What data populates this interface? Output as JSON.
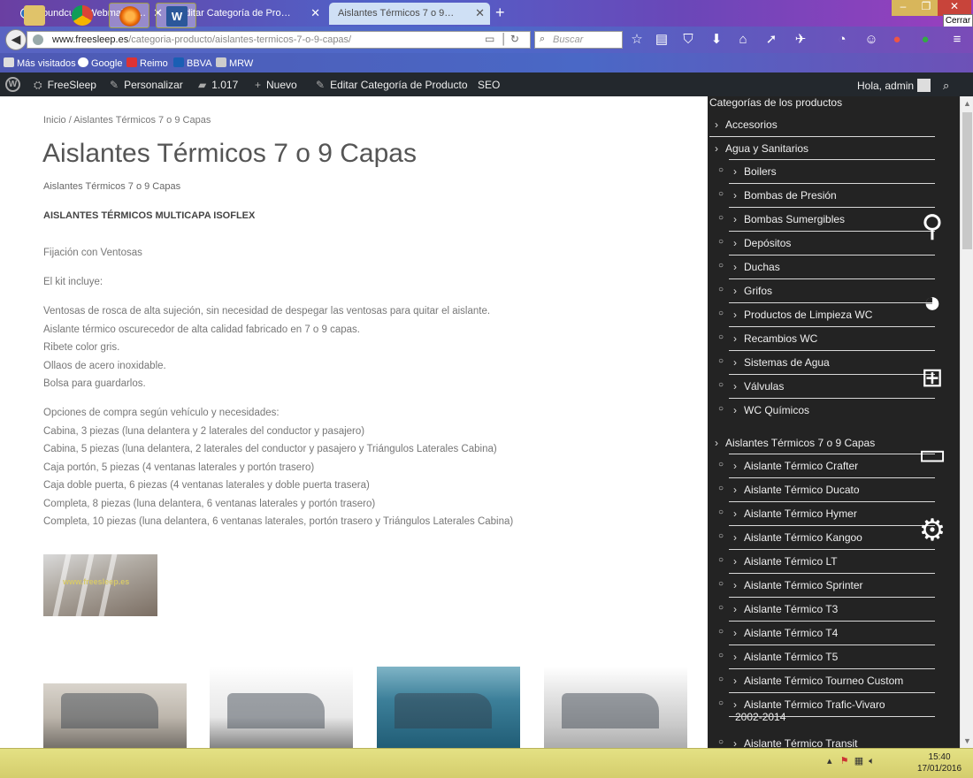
{
  "browser": {
    "tabs": [
      {
        "label": "Roundcube Webmail :: En..."
      },
      {
        "label": "Editar Categoría de Producto ‹..."
      },
      {
        "label": "Aislantes Térmicos 7 o 9 Capa..."
      }
    ],
    "close_tooltip": "Cerrar",
    "url_host": "www.freesleep.es",
    "url_path": "/categoria-producto/aislantes-termicos-7-o-9-capas/",
    "search_placeholder": "Buscar",
    "bookmarks": [
      "Más visitados",
      "Google",
      "Reimo",
      "BBVA",
      "MRW"
    ]
  },
  "adminbar": {
    "site": "FreeSleep",
    "customize": "Personalizar",
    "comments": "1.017",
    "new": "Nuevo",
    "edit": "Editar Categoría de Producto",
    "seo": "SEO",
    "greeting": "Hola, admin"
  },
  "main": {
    "breadcrumb": "Inicio / Aislantes Térmicos 7 o 9 Capas",
    "title": "Aislantes Térmicos 7 o 9 Capas",
    "subtitle": "Aislantes Térmicos 7 o 9 Capas",
    "heading": "AISLANTES TÉRMICOS MULTICAPA ISOFLEX",
    "fixation": "Fijación con Ventosas",
    "kit_intro": "El kit incluye:",
    "kit_items": [
      "Ventosas de rosca de alta sujeción, sin necesidad de despegar las ventosas para quitar el aislante.",
      "Aislante térmico oscurecedor de alta calidad fabricado en 7 o 9 capas.",
      "Ribete color gris.",
      "Ollaos de acero inoxidable.",
      "Bolsa para guardarlos."
    ],
    "options_intro": "Opciones de compra según vehículo y necesidades:",
    "options": [
      "Cabina, 3 piezas (luna delantera y 2 laterales del conductor y pasajero)",
      "Cabina, 5 piezas (luna delantera, 2 laterales del conductor y pasajero y Triángulos Laterales Cabina)",
      "Caja portón, 5 piezas (4 ventanas laterales y portón trasero)",
      "Caja doble puerta, 6 piezas (4 ventanas laterales y doble puerta trasera)",
      "Completa, 8 piezas (luna delantera, 6 ventanas laterales y portón trasero)",
      "Completa, 10 piezas (luna delantera, 6 ventanas laterales, portón trasero y Triángulos Laterales Cabina)"
    ],
    "watermark": "www.freesleep.es"
  },
  "sidebar": {
    "title": "Categorías de los productos",
    "accesorios": "Accesorios",
    "agua": "Agua y Sanitarios",
    "agua_items": [
      "Boilers",
      "Bombas de Presión",
      "Bombas Sumergibles",
      "Depósitos",
      "Duchas",
      "Grifos",
      "Productos de Limpieza WC",
      "Recambios WC",
      "Sistemas de Agua",
      "Válvulas",
      "WC Químicos"
    ],
    "aislantes": "Aislantes Térmicos 7 o 9 Capas",
    "aislantes_items": [
      "Aislante Térmico Crafter",
      "Aislante Térmico Ducato",
      "Aislante Térmico Hymer",
      "Aislante Térmico Kangoo",
      "Aislante Térmico LT",
      "Aislante Térmico Sprinter",
      "Aislante Térmico T3",
      "Aislante Térmico T4",
      "Aislante Térmico T5",
      "Aislante Térmico Tourneo Custom",
      "Aislante Térmico Trafic-Vivaro",
      "Aislante Térmico Transit"
    ],
    "trafic_line2": "2002-2014"
  },
  "taskbar": {
    "time": "15:40",
    "date": "17/01/2016"
  },
  "colors": {
    "adminbar_bg": "#23282d",
    "sidebar_bg": "#232323",
    "taskbar_bg": "#d4cd6c"
  }
}
